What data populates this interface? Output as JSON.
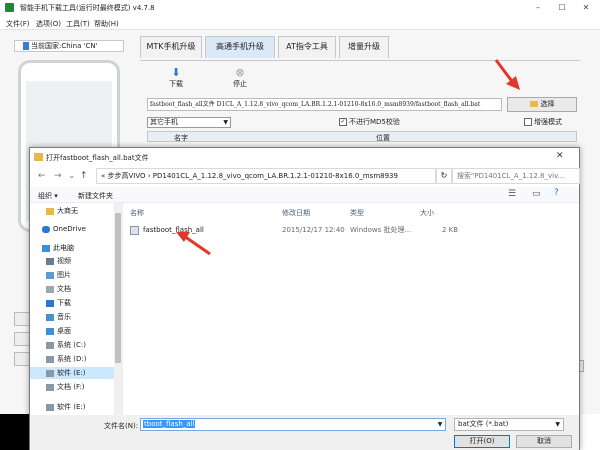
{
  "app": {
    "title": "智能手机下载工具(运行时最终模式)   v4.7.8",
    "menu": [
      "文件(F)",
      "选项(O)",
      "工具(T)",
      "帮助(H)"
    ],
    "country": "当前国家:China 'CN'",
    "tabs": [
      "MTK手机升级",
      "高通手机升级",
      "AT指令工具",
      "增量升级"
    ],
    "toolbar": {
      "download_label": "下载",
      "stop_label": "停止",
      "download_icon": "down-arrow-icon",
      "stop_icon": "stop-icon"
    },
    "path_value": "fastboot_flash_all文件      D1CL_A_1.12.8_vivo_qcom_LA.BR.1.2.1-01210-8x16.0_msm8939/fastboot_flash_all.bat",
    "select_label": "选择",
    "phone_type": "其它手机",
    "md5_check_label": "不进行MD5校验",
    "enhanced_check_label": "增强模式",
    "list_columns": [
      "名字",
      "位置"
    ],
    "side_btn_partial": "t"
  },
  "dialog": {
    "title": "打开fastboot_flash_all.bat文件",
    "address": "«  步步高VIVO  ›  PD1401CL_A_1.12.8_vivo_qcom_LA.BR.1.2.1-01210-8x16.0_msm8939",
    "search_placeholder": "搜索\"PD1401CL_A_1.12.8_viv...",
    "organize_label": "组织 ▾",
    "new_folder_label": "新建文件夹",
    "nav_items": [
      {
        "label": "大商无",
        "icon": "folder-icon"
      },
      {
        "label": "OneDrive",
        "icon": "cloud-icon"
      },
      {
        "label": "此电脑",
        "icon": "computer-icon"
      },
      {
        "label": "视频",
        "icon": "video-icon"
      },
      {
        "label": "图片",
        "icon": "picture-icon"
      },
      {
        "label": "文档",
        "icon": "document-icon"
      },
      {
        "label": "下载",
        "icon": "download-icon"
      },
      {
        "label": "音乐",
        "icon": "music-icon"
      },
      {
        "label": "桌面",
        "icon": "desktop-icon"
      },
      {
        "label": "系统 (C:)",
        "icon": "drive-icon"
      },
      {
        "label": "系统 (D:)",
        "icon": "drive-icon"
      },
      {
        "label": "软件 (E:)",
        "icon": "drive-icon"
      },
      {
        "label": "文档 (F:)",
        "icon": "drive-icon"
      },
      {
        "label": "软件 (E:)",
        "icon": "drive-icon"
      }
    ],
    "columns": {
      "name": "名称",
      "modified": "修改日期",
      "type": "类型",
      "size": "大小"
    },
    "file": {
      "name": "fastboot_flash_all",
      "modified": "2015/12/17 12:40",
      "type": "Windows 批处理...",
      "size": "2 KB"
    },
    "filename_label": "文件名(N):",
    "filename_value": "tboot_flash_all",
    "filetype_value": "bat文件 (*.bat)",
    "open_label": "打开(O)",
    "cancel_label": "取消"
  },
  "colors": {
    "annotation_arrow": "#e0382a",
    "tab_active": "#dbe8f7"
  }
}
